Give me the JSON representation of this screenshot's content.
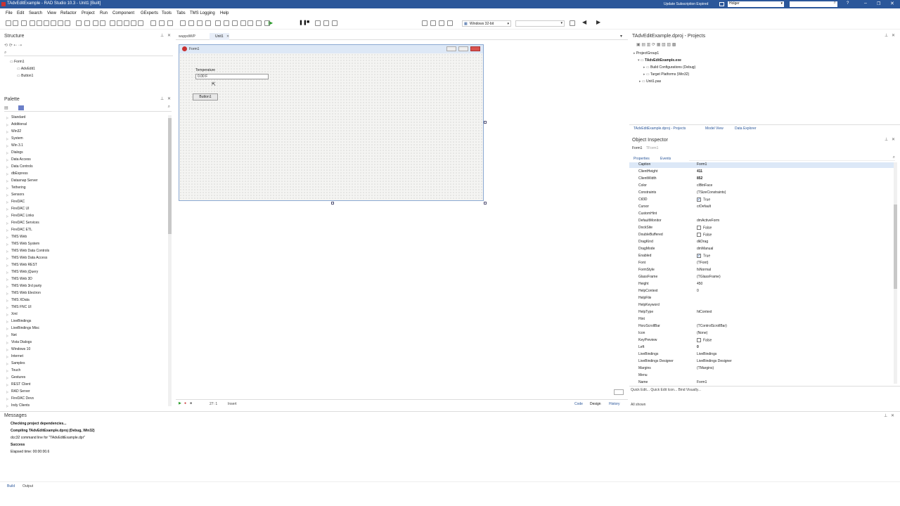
{
  "window": {
    "title": "TAdvEditExample - RAD Studio 10.3 - Unit1 [Built]"
  },
  "titlebar_right": {
    "subscription": "Update Subscription Expired",
    "user": "Holger",
    "search_placeholder": ""
  },
  "menu": [
    "File",
    "Edit",
    "Search",
    "View",
    "Refactor",
    "Project",
    "Run",
    "Component",
    "GExperts",
    "Tools",
    "Tabs",
    "TMS Logging",
    "Help"
  ],
  "toolbar": {
    "platform": "Windows 32-bit",
    "config": ""
  },
  "doc_tabs": [
    "wuppdiWP",
    "Unit1"
  ],
  "structure": {
    "title": "Structure",
    "items": [
      "Form1",
      "AdvEdit1",
      "Button1"
    ]
  },
  "palette": {
    "title": "Palette",
    "items": [
      "Standard",
      "Additional",
      "Win32",
      "System",
      "Win 3.1",
      "Dialogs",
      "Data Access",
      "Data Controls",
      "dbExpress",
      "Datasnap Server",
      "Tethering",
      "Sensors",
      "FireDAC",
      "FireDAC UI",
      "FireDAC Links",
      "FireDAC Services",
      "FireDAC ETL",
      "TMS Web",
      "TMS Web System",
      "TMS Web Data Controls",
      "TMS Web Data Access",
      "TMS Web REST",
      "TMS Web jQuery",
      "TMS Web 3D",
      "TMS Web 3rd party",
      "TMS Web Electron",
      "TMS XData",
      "TMS FNC UI",
      "Xml",
      "LiveBindings",
      "LiveBindings Misc",
      "Net",
      "Vista Dialogs",
      "Windows 10",
      "Internet",
      "Samples",
      "Touch",
      "Gestures",
      "REST Client",
      "RAD Server",
      "FireDAC Devs",
      "Indy Clients"
    ]
  },
  "designer": {
    "form_caption": "Form1",
    "label": "Temperature",
    "edit_value": "0.00 F",
    "button": "Button1"
  },
  "editor_status": {
    "position": "27: 1",
    "mode": "Insert",
    "tabs": [
      "Code",
      "Design",
      "History"
    ]
  },
  "projects": {
    "title": "TAdvEditExample.dproj - Projects",
    "items": [
      "ProjectGroup1",
      "TAdvEditExample.exe",
      "Build Configurations (Debug)",
      "Target Platforms (Win32)",
      "Unit1.pas"
    ],
    "tabs": [
      "TAdvEditExample.dproj - Projects",
      "Model View",
      "Data Explorer"
    ]
  },
  "object_inspector": {
    "title": "Object Inspector",
    "selected": "Form1",
    "selected_type": "TForm1",
    "tabs": [
      "Properties",
      "Events"
    ],
    "rows": [
      {
        "name": "Caption",
        "value": "Form1",
        "check": false
      },
      {
        "name": "ClientHeight",
        "value": "411",
        "check": false
      },
      {
        "name": "ClientWidth",
        "value": "852",
        "check": false
      },
      {
        "name": "Color",
        "value": "clBtnFace",
        "check": false
      },
      {
        "name": "Constraints",
        "value": "(TSizeConstraints)",
        "check": false
      },
      {
        "name": "Ctl3D",
        "value": "True",
        "check": true
      },
      {
        "name": "Cursor",
        "value": "crDefault",
        "check": false
      },
      {
        "name": "CustomHint",
        "value": "",
        "check": false
      },
      {
        "name": "DefaultMonitor",
        "value": "dmActiveForm",
        "check": false
      },
      {
        "name": "DockSite",
        "value": "False",
        "check": true
      },
      {
        "name": "DoubleBuffered",
        "value": "False",
        "check": true
      },
      {
        "name": "DragKind",
        "value": "dkDrag",
        "check": false
      },
      {
        "name": "DragMode",
        "value": "dmManual",
        "check": false
      },
      {
        "name": "Enabled",
        "value": "True",
        "check": true
      },
      {
        "name": "Font",
        "value": "(TFont)",
        "check": false
      },
      {
        "name": "FormStyle",
        "value": "fsNormal",
        "check": false
      },
      {
        "name": "GlassFrame",
        "value": "(TGlassFrame)",
        "check": false
      },
      {
        "name": "Height",
        "value": "450",
        "check": false
      },
      {
        "name": "HelpContext",
        "value": "0",
        "check": false
      },
      {
        "name": "HelpFile",
        "value": "",
        "check": false
      },
      {
        "name": "HelpKeyword",
        "value": "",
        "check": false
      },
      {
        "name": "HelpType",
        "value": "htContext",
        "check": false
      },
      {
        "name": "Hint",
        "value": "",
        "check": false
      },
      {
        "name": "HorzScrollBar",
        "value": "(TControlScrollBar)",
        "check": false
      },
      {
        "name": "Icon",
        "value": "(None)",
        "check": false
      },
      {
        "name": "KeyPreview",
        "value": "False",
        "check": true
      },
      {
        "name": "Left",
        "value": "0",
        "check": false
      },
      {
        "name": "LiveBindings",
        "value": "LiveBindings",
        "check": false
      },
      {
        "name": "LiveBindings Designer",
        "value": "LiveBindings Designer",
        "check": false
      },
      {
        "name": "Margins",
        "value": "(TMargins)",
        "check": false
      },
      {
        "name": "Menu",
        "value": "",
        "check": false
      },
      {
        "name": "Name",
        "value": "Form1",
        "check": false
      }
    ],
    "quick_edit": "Quick Edit... Quick Edit Icon... Bind Visually...",
    "footer": "All shown"
  },
  "messages": {
    "title": "Messages",
    "lines": [
      "Checking project dependencies...",
      "Compiling TAdvEditExample.dproj (Debug, Win32)",
      "dcc32 command line for \"TAdvEditExample.dpr\"",
      "Success",
      "Elapsed time: 00:00:00.6"
    ],
    "tabs": [
      "Build",
      "Output"
    ]
  },
  "colors": {
    "titlebar": "#2b579a",
    "accent": "#2b579a",
    "form_border": "#b9cde7"
  }
}
